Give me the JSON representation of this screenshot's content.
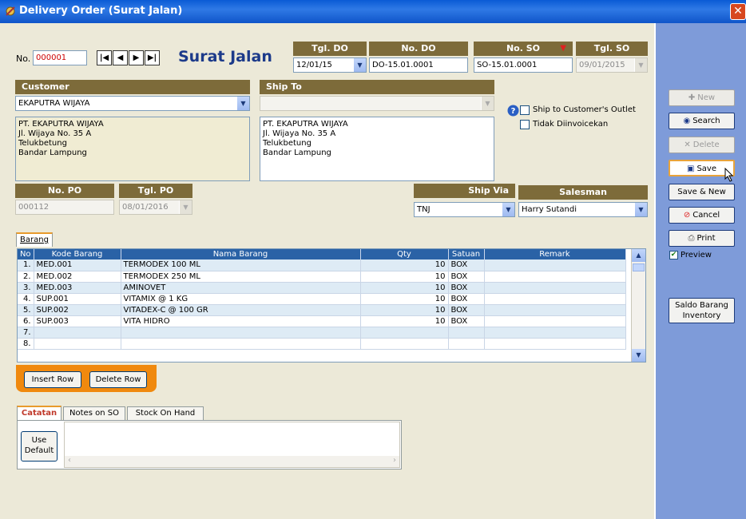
{
  "window": {
    "title": "Delivery Order (Surat Jalan)",
    "close": "✕"
  },
  "header": {
    "no_label": "No.",
    "no_value": "000001",
    "nav": [
      "|◀",
      "◀",
      "▶",
      "▶|"
    ],
    "page_title": "Surat Jalan",
    "tgl_do_label": "Tgl. DO",
    "tgl_do_value": "12/01/15",
    "no_do_label": "No. DO",
    "no_do_value": "DO-15.01.0001",
    "no_so_label": "No. SO",
    "no_so_value": "SO-15.01.0001",
    "tgl_so_label": "Tgl. SO",
    "tgl_so_value": "09/01/2015"
  },
  "customer": {
    "label": "Customer",
    "value": "EKAPUTRA WIJAYA",
    "address": "PT. EKAPUTRA WIJAYA\nJl. Wijaya No. 35 A\nTelukbetung\nBandar Lampung"
  },
  "ship_to": {
    "label": "Ship To",
    "value": "",
    "address": "PT. EKAPUTRA WIJAYA\nJl. Wijaya No. 35 A\nTelukbetung\nBandar Lampung"
  },
  "options": {
    "ship_outlet": "Ship to Customer's Outlet",
    "tidak_diinvoicekan": "Tidak Diinvoicekan"
  },
  "po": {
    "no_po_label": "No. PO",
    "no_po_value": "000112",
    "tgl_po_label": "Tgl. PO",
    "tgl_po_value": "08/01/2016"
  },
  "ship_via": {
    "label": "Ship Via",
    "value": "TNJ"
  },
  "salesman": {
    "label": "Salesman",
    "value": "Harry Sutandi"
  },
  "items_tab": "Barang",
  "grid": {
    "columns": [
      "No",
      "Kode Barang",
      "Nama Barang",
      "Qty",
      "Satuan",
      "Remark"
    ],
    "rows": [
      {
        "no": "1.",
        "kode": "MED.001",
        "nama": "TERMODEX 100 ML",
        "qty": "10",
        "satuan": "BOX",
        "remark": ""
      },
      {
        "no": "2.",
        "kode": "MED.002",
        "nama": "TERMODEX 250 ML",
        "qty": "10",
        "satuan": "BOX",
        "remark": ""
      },
      {
        "no": "3.",
        "kode": "MED.003",
        "nama": "AMINOVET",
        "qty": "10",
        "satuan": "BOX",
        "remark": ""
      },
      {
        "no": "4.",
        "kode": "SUP.001",
        "nama": "VITAMIX @ 1 KG",
        "qty": "10",
        "satuan": "BOX",
        "remark": ""
      },
      {
        "no": "5.",
        "kode": "SUP.002",
        "nama": "VITADEX-C @ 100 GR",
        "qty": "10",
        "satuan": "BOX",
        "remark": ""
      },
      {
        "no": "6.",
        "kode": "SUP.003",
        "nama": "VITA HIDRO",
        "qty": "10",
        "satuan": "BOX",
        "remark": ""
      },
      {
        "no": "7.",
        "kode": "",
        "nama": "",
        "qty": "",
        "satuan": "",
        "remark": ""
      },
      {
        "no": "8.",
        "kode": "",
        "nama": "",
        "qty": "",
        "satuan": "",
        "remark": ""
      }
    ]
  },
  "row_buttons": {
    "insert": "Insert Row",
    "delete": "Delete Row"
  },
  "bottom_tabs": [
    "Catatan",
    "Notes on SO",
    "Stock On Hand"
  ],
  "use_default": "Use Default",
  "side": {
    "new": "New",
    "search": "Search",
    "delete": "Delete",
    "save": "Save",
    "save_new": "Save & New",
    "cancel": "Cancel",
    "print": "Print",
    "preview": "Preview",
    "saldo": "Saldo Barang Inventory"
  },
  "colors": {
    "header_bar": "#7d6b3a",
    "title_blue": "#1c3a8a",
    "panel": "#7e9bd9",
    "accent_orange": "#f0890e"
  }
}
